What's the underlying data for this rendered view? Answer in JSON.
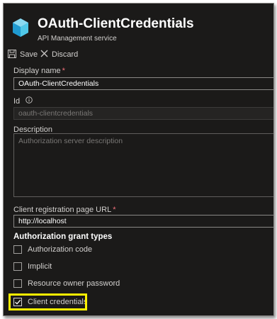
{
  "header": {
    "title": "OAuth-ClientCredentials",
    "subtitle": "API Management service",
    "more": "···"
  },
  "toolbar": {
    "save_label": "Save",
    "discard_label": "Discard"
  },
  "form": {
    "display_name": {
      "label": "Display name",
      "required": "*",
      "value": "OAuth-ClientCredentials"
    },
    "id": {
      "label": "Id",
      "value": "oauth-clientcredentials"
    },
    "description": {
      "label": "Description",
      "placeholder": "Authorization server description"
    },
    "client_reg_url": {
      "label": "Client registration page URL",
      "required": "*",
      "value": "http://localhost"
    },
    "grant_types": {
      "title": "Authorization grant types",
      "options": [
        {
          "label": "Authorization code",
          "checked": false
        },
        {
          "label": "Implicit",
          "checked": false
        },
        {
          "label": "Resource owner password",
          "checked": false
        },
        {
          "label": "Client credentials",
          "checked": true
        }
      ]
    }
  },
  "colors": {
    "background": "#1b1a19",
    "required": "#f1707b",
    "highlight": "#fff200",
    "icon": "#50c8e8"
  }
}
